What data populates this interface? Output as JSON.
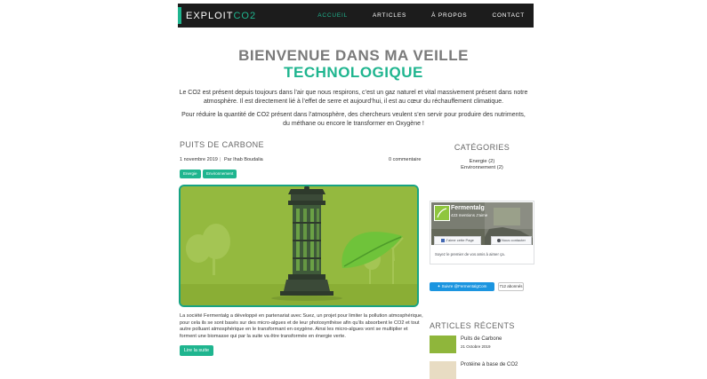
{
  "brand": {
    "prefix": "EXPLOIT",
    "accent": "CO2"
  },
  "nav": {
    "items": [
      {
        "label": "ACCUEIL",
        "active": true
      },
      {
        "label": "ARTICLES",
        "active": false
      },
      {
        "label": "À PROPOS",
        "active": false
      },
      {
        "label": "CONTACT",
        "active": false
      }
    ]
  },
  "hero": {
    "title_line1": "BIENVENUE DANS MA VEILLE",
    "title_line2": "TECHNOLOGIQUE",
    "intro_1": "Le CO2 est présent depuis toujours dans l’air que nous respirons, c’est un gaz naturel et vital massivement présent dans notre atmosphère. Il est directement lié à l’effet de serre et aujourd’hui, il est au cœur du réchauffement climatique.",
    "intro_2": "Pour réduire la quantité de CO2 présent dans l’atmosphère, des chercheurs veulent s’en servir pour produire des nutriments, du méthane ou encore le transformer en Oxygène !"
  },
  "post": {
    "title": "PUITS DE CARBONE",
    "date": "1 novembre 2019",
    "author": "Par Ihab Boudalia",
    "comments": "0 commentaire",
    "tags": [
      "Energie",
      "Environnement"
    ],
    "excerpt": "La société Fermentalg a développé en partenariat avec Suez, un projet pour limiter la pollution atmosphérique, pour cela ils se sont basés sur des micro-algues et de leur photosynthèse afin qu’ils absorbent le CO2 et tout autre polluant atmosphérique en le transformant en oxygène. Ainsi les micro-algues vont se multiplier et forment une biomasse qui par la suite va être transformée en énergie verte.",
    "read_more": "Lire la suite"
  },
  "sidebar": {
    "categories_title": "CATÉGORIES",
    "categories": [
      "Energie (2)",
      "Environnement (2)"
    ],
    "facebook": {
      "name": "Fermentalg",
      "likes": "423 mentions J’aime",
      "like_button": "J’aime cette Page",
      "contact_button": "Nous contacter",
      "note": "Soyez le premier de vos amis à aimer ça."
    },
    "twitter": {
      "follow": "Suivre @FermentalgCom",
      "count": "712 abonnés"
    },
    "recent_title": "ARTICLES RÉCENTS",
    "recent": [
      {
        "title": "Puits de Carbone",
        "date": "21 Octobre 2019"
      },
      {
        "title": "Protéine à base de CO2",
        "date": ""
      }
    ]
  },
  "colors": {
    "accent": "#1fb58f",
    "navbar": "#1c1c1c",
    "heading_grey": "#7a7a7a"
  }
}
